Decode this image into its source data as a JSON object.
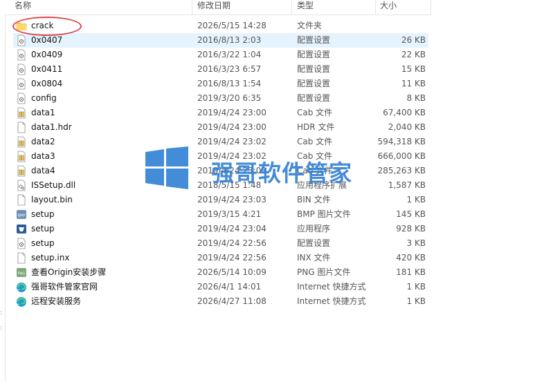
{
  "columns": {
    "name": "名称",
    "date": "修改日期",
    "type": "类型",
    "size": "大小"
  },
  "files": [
    {
      "name": "crack",
      "date": "2026/5/15 14:28",
      "type": "文件夹",
      "size": "",
      "icon": "folder-icon"
    },
    {
      "name": "0x0407",
      "date": "2016/8/13 2:03",
      "type": "配置设置",
      "size": "26 KB",
      "icon": "config-file-icon",
      "selected": true
    },
    {
      "name": "0x0409",
      "date": "2016/3/22 1:04",
      "type": "配置设置",
      "size": "22 KB",
      "icon": "config-file-icon"
    },
    {
      "name": "0x0411",
      "date": "2016/3/23 6:57",
      "type": "配置设置",
      "size": "15 KB",
      "icon": "config-file-icon"
    },
    {
      "name": "0x0804",
      "date": "2016/8/13 1:54",
      "type": "配置设置",
      "size": "11 KB",
      "icon": "config-file-icon"
    },
    {
      "name": "config",
      "date": "2019/3/20 6:35",
      "type": "配置设置",
      "size": "8 KB",
      "icon": "config-file-icon"
    },
    {
      "name": "data1",
      "date": "2019/4/24 23:00",
      "type": "Cab 文件",
      "size": "67,400 KB",
      "icon": "cab-file-icon"
    },
    {
      "name": "data1.hdr",
      "date": "2019/4/24 23:00",
      "type": "HDR 文件",
      "size": "2,040 KB",
      "icon": "blank-file-icon"
    },
    {
      "name": "data2",
      "date": "2019/4/24 23:02",
      "type": "Cab 文件",
      "size": "594,318 KB",
      "icon": "cab-file-icon"
    },
    {
      "name": "data3",
      "date": "2019/4/24 23:02",
      "type": "Cab 文件",
      "size": "666,000 KB",
      "icon": "cab-file-icon"
    },
    {
      "name": "data4",
      "date": "2019/4/24 23:03",
      "type": "Cab 文件",
      "size": "285,263 KB",
      "icon": "cab-file-icon"
    },
    {
      "name": "ISSetup.dll",
      "date": "2018/5/15 1:48",
      "type": "应用程序扩展",
      "size": "1,587 KB",
      "icon": "dll-file-icon"
    },
    {
      "name": "layout.bin",
      "date": "2019/4/24 23:03",
      "type": "BIN 文件",
      "size": "1 KB",
      "icon": "blank-file-icon"
    },
    {
      "name": "setup",
      "date": "2019/3/15 4:21",
      "type": "BMP 图片文件",
      "size": "145 KB",
      "icon": "bmp-file-icon"
    },
    {
      "name": "setup",
      "date": "2019/4/24 23:04",
      "type": "应用程序",
      "size": "928 KB",
      "icon": "setup-app-icon"
    },
    {
      "name": "setup",
      "date": "2019/4/24 22:56",
      "type": "配置设置",
      "size": "3 KB",
      "icon": "config-file-icon"
    },
    {
      "name": "setup.inx",
      "date": "2019/4/24 22:56",
      "type": "INX 文件",
      "size": "420 KB",
      "icon": "blank-file-icon"
    },
    {
      "name": "查看Origin安装步骤",
      "date": "2026/5/14 10:09",
      "type": "PNG 图片文件",
      "size": "181 KB",
      "icon": "png-file-icon"
    },
    {
      "name": "强哥软件管家官网",
      "date": "2026/4/1 14:01",
      "type": "Internet 快捷方式",
      "size": "1 KB",
      "icon": "edge-shortcut-icon"
    },
    {
      "name": "远程安装服务",
      "date": "2026/4/27 11:08",
      "type": "Internet 快捷方式",
      "size": "1 KB",
      "icon": "edge-shortcut-icon"
    }
  ],
  "watermark": {
    "text": "强哥软件管家",
    "color": "#2f7fd4"
  },
  "colors": {
    "selection": "#e5f3ff",
    "folder": "#f6c94c",
    "highlight_circle": "#e0444a"
  }
}
